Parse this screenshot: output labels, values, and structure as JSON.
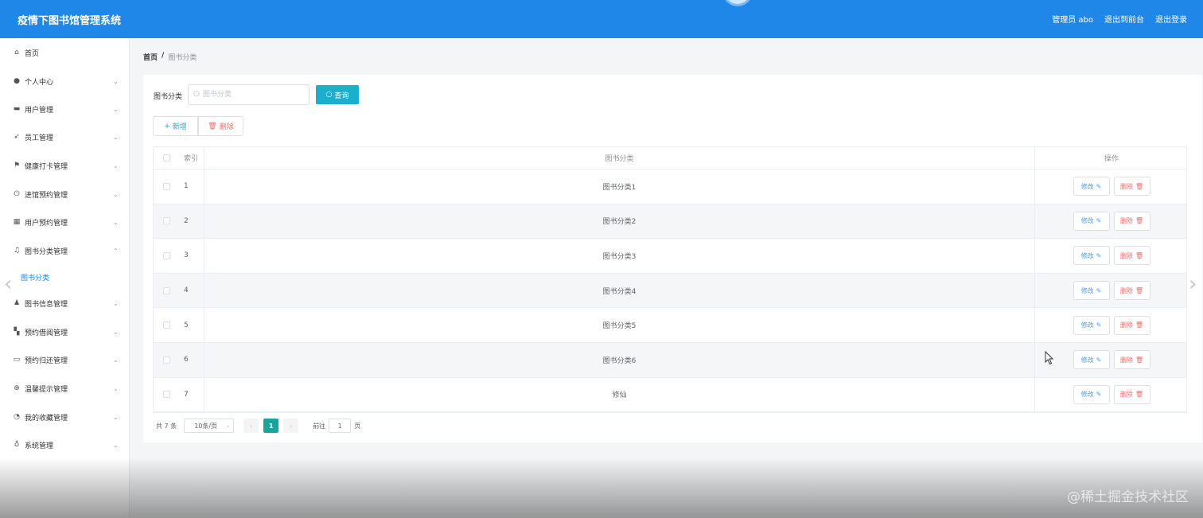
{
  "header": {
    "title": "疫情下图书馆管理系统",
    "admin_label": "管理员 abo",
    "to_front_label": "退出到前台",
    "logout_label": "退出登录"
  },
  "sidebar": {
    "items": [
      {
        "label": "首页",
        "icon": "home-icon"
      },
      {
        "label": "个人中心",
        "icon": "user-icon"
      },
      {
        "label": "用户管理",
        "icon": "ticket-icon"
      },
      {
        "label": "员工管理",
        "icon": "send-icon"
      },
      {
        "label": "健康打卡管理",
        "icon": "flag-icon"
      },
      {
        "label": "进馆预约管理",
        "icon": "power-icon"
      },
      {
        "label": "用户预约管理",
        "icon": "grid-icon"
      },
      {
        "label": "图书分类管理",
        "icon": "bell-icon"
      },
      {
        "label": "图书信息管理",
        "icon": "stamp-icon"
      },
      {
        "label": "预约借阅管理",
        "icon": "menu-icon"
      },
      {
        "label": "预约归还管理",
        "icon": "chat-icon"
      },
      {
        "label": "温馨提示管理",
        "icon": "help-icon"
      },
      {
        "label": "我的收藏管理",
        "icon": "compass-icon"
      },
      {
        "label": "系统管理",
        "icon": "mic-icon"
      }
    ],
    "sub_item": "图书分类"
  },
  "breadcrumb": {
    "home": "首页",
    "sep": "/",
    "current": "图书分类"
  },
  "search": {
    "label": "图书分类",
    "placeholder": "图书分类",
    "query_label": "查询"
  },
  "toolbar": {
    "add_label": "新增",
    "delete_label": "删除"
  },
  "table": {
    "col_index": "索引",
    "col_name": "图书分类",
    "col_ops": "操作",
    "edit_label": "修改",
    "delete_label": "删除",
    "rows": [
      {
        "index": "1",
        "name": "图书分类1"
      },
      {
        "index": "2",
        "name": "图书分类2"
      },
      {
        "index": "3",
        "name": "图书分类3"
      },
      {
        "index": "4",
        "name": "图书分类4"
      },
      {
        "index": "5",
        "name": "图书分类5"
      },
      {
        "index": "6",
        "name": "图书分类6"
      },
      {
        "index": "7",
        "name": "修仙"
      }
    ]
  },
  "pagination": {
    "total": "共 7 条",
    "page_size": "10条/页",
    "current_page": "1",
    "goto_label": "前往",
    "goto_value": "1",
    "page_unit": "页"
  },
  "watermark": "@稀土掘金技术社区",
  "colors": {
    "header_bg": "#1f87e8",
    "query_button": "#1ab0cd",
    "active_page": "#13a89e",
    "danger": "#f56c6c",
    "link": "#409eff"
  }
}
